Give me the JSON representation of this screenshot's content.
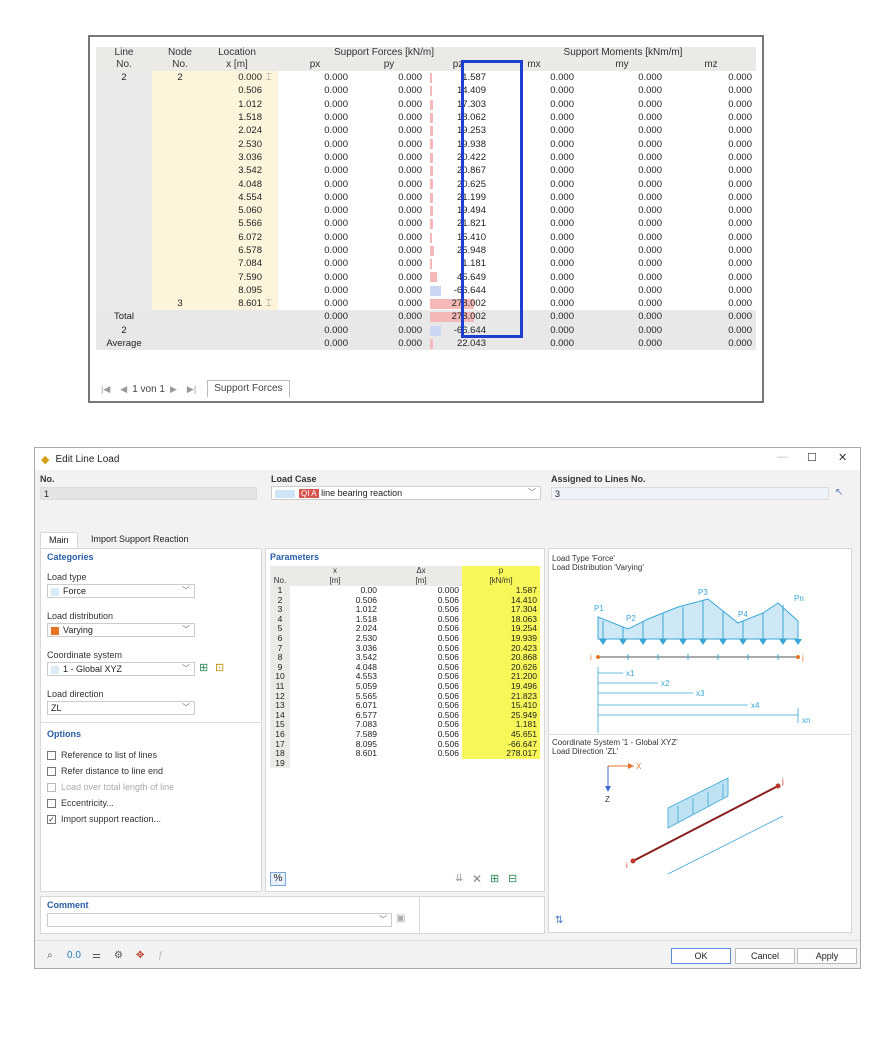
{
  "support_table": {
    "headers": {
      "line": [
        "Line",
        "No."
      ],
      "node": [
        "Node",
        "No."
      ],
      "location": [
        "Location",
        "x [m]"
      ],
      "forces_group": "Support Forces [kN/m]",
      "moments_group": "Support Moments [kNm/m]",
      "px": "px",
      "py": "py",
      "pz": "pz",
      "mx": "mx",
      "my": "my",
      "mz": "mz"
    },
    "line_no": "2",
    "rows": [
      {
        "node": "2",
        "x": "0.000",
        "sym": "⌶",
        "px": "0.000",
        "py": "0.000",
        "pz": "1.587",
        "pzval": 1.587,
        "mx": "0.000",
        "my": "0.000",
        "mz": "0.000"
      },
      {
        "node": "",
        "x": "0.506",
        "sym": "",
        "px": "0.000",
        "py": "0.000",
        "pz": "14.409",
        "pzval": 14.409,
        "mx": "0.000",
        "my": "0.000",
        "mz": "0.000"
      },
      {
        "node": "",
        "x": "1.012",
        "sym": "",
        "px": "0.000",
        "py": "0.000",
        "pz": "17.303",
        "pzval": 17.303,
        "mx": "0.000",
        "my": "0.000",
        "mz": "0.000"
      },
      {
        "node": "",
        "x": "1.518",
        "sym": "",
        "px": "0.000",
        "py": "0.000",
        "pz": "18.062",
        "pzval": 18.062,
        "mx": "0.000",
        "my": "0.000",
        "mz": "0.000"
      },
      {
        "node": "",
        "x": "2.024",
        "sym": "",
        "px": "0.000",
        "py": "0.000",
        "pz": "19.253",
        "pzval": 19.253,
        "mx": "0.000",
        "my": "0.000",
        "mz": "0.000"
      },
      {
        "node": "",
        "x": "2.530",
        "sym": "",
        "px": "0.000",
        "py": "0.000",
        "pz": "19.938",
        "pzval": 19.938,
        "mx": "0.000",
        "my": "0.000",
        "mz": "0.000"
      },
      {
        "node": "",
        "x": "3.036",
        "sym": "",
        "px": "0.000",
        "py": "0.000",
        "pz": "20.422",
        "pzval": 20.422,
        "mx": "0.000",
        "my": "0.000",
        "mz": "0.000"
      },
      {
        "node": "",
        "x": "3.542",
        "sym": "",
        "px": "0.000",
        "py": "0.000",
        "pz": "20.867",
        "pzval": 20.867,
        "mx": "0.000",
        "my": "0.000",
        "mz": "0.000"
      },
      {
        "node": "",
        "x": "4.048",
        "sym": "",
        "px": "0.000",
        "py": "0.000",
        "pz": "20.625",
        "pzval": 20.625,
        "mx": "0.000",
        "my": "0.000",
        "mz": "0.000"
      },
      {
        "node": "",
        "x": "4.554",
        "sym": "",
        "px": "0.000",
        "py": "0.000",
        "pz": "21.199",
        "pzval": 21.199,
        "mx": "0.000",
        "my": "0.000",
        "mz": "0.000"
      },
      {
        "node": "",
        "x": "5.060",
        "sym": "",
        "px": "0.000",
        "py": "0.000",
        "pz": "19.494",
        "pzval": 19.494,
        "mx": "0.000",
        "my": "0.000",
        "mz": "0.000"
      },
      {
        "node": "",
        "x": "5.566",
        "sym": "",
        "px": "0.000",
        "py": "0.000",
        "pz": "21.821",
        "pzval": 21.821,
        "mx": "0.000",
        "my": "0.000",
        "mz": "0.000"
      },
      {
        "node": "",
        "x": "6.072",
        "sym": "",
        "px": "0.000",
        "py": "0.000",
        "pz": "15.410",
        "pzval": 15.41,
        "mx": "0.000",
        "my": "0.000",
        "mz": "0.000"
      },
      {
        "node": "",
        "x": "6.578",
        "sym": "",
        "px": "0.000",
        "py": "0.000",
        "pz": "25.948",
        "pzval": 25.948,
        "mx": "0.000",
        "my": "0.000",
        "mz": "0.000"
      },
      {
        "node": "",
        "x": "7.084",
        "sym": "",
        "px": "0.000",
        "py": "0.000",
        "pz": "1.181",
        "pzval": 1.181,
        "mx": "0.000",
        "my": "0.000",
        "mz": "0.000"
      },
      {
        "node": "",
        "x": "7.590",
        "sym": "",
        "px": "0.000",
        "py": "0.000",
        "pz": "45.649",
        "pzval": 45.649,
        "mx": "0.000",
        "my": "0.000",
        "mz": "0.000"
      },
      {
        "node": "",
        "x": "8.095",
        "sym": "",
        "px": "0.000",
        "py": "0.000",
        "pz": "-66.644",
        "pzval": -66.644,
        "mx": "0.000",
        "my": "0.000",
        "mz": "0.000"
      },
      {
        "node": "3",
        "x": "8.601",
        "sym": "⌶",
        "px": "0.000",
        "py": "0.000",
        "pz": "278.002",
        "pzval": 278.002,
        "mx": "0.000",
        "my": "0.000",
        "mz": "0.000"
      }
    ],
    "summary": [
      {
        "label": "Total",
        "px": "0.000",
        "py": "0.000",
        "pz": "278.002",
        "pzval": 278.002,
        "mx": "0.000",
        "my": "0.000",
        "mz": "0.000"
      },
      {
        "label": "2",
        "px": "0.000",
        "py": "0.000",
        "pz": "-66.644",
        "pzval": -66.644,
        "mx": "0.000",
        "my": "0.000",
        "mz": "0.000"
      },
      {
        "label": "Average",
        "px": "0.000",
        "py": "0.000",
        "pz": "22.043",
        "pzval": 22.043,
        "mx": "0.000",
        "my": "0.000",
        "mz": "0.000"
      }
    ],
    "pager": "1 von 1",
    "sheet_tab": "Support Forces",
    "colors": {
      "positive_bar": "#f4b8b8",
      "negative_bar": "#c9d7f2",
      "highlight": "#1c3fd0"
    }
  },
  "dialog": {
    "title": "Edit Line Load",
    "no_label": "No.",
    "no_value": "1",
    "load_case_label": "Load Case",
    "load_case_code": "QI A",
    "load_case_name": "line bearing reaction",
    "assigned_label": "Assigned to Lines No.",
    "assigned_value": "3",
    "tabs": [
      "Main",
      "Import Support Reaction"
    ],
    "categories": {
      "heading": "Categories",
      "load_type_label": "Load type",
      "load_type_value": "Force",
      "load_dist_label": "Load distribution",
      "load_dist_value": "Varying",
      "coord_label": "Coordinate system",
      "coord_value": "1 - Global XYZ",
      "direction_label": "Load direction",
      "direction_value": "ZL"
    },
    "options": {
      "heading": "Options",
      "items": [
        {
          "label": "Reference to list of lines",
          "checked": false,
          "enabled": true
        },
        {
          "label": "Refer distance to line end",
          "checked": false,
          "enabled": true
        },
        {
          "label": "Load over total length of line",
          "checked": false,
          "enabled": false
        },
        {
          "label": "Eccentricity...",
          "checked": false,
          "enabled": true
        },
        {
          "label": "Import support reaction...",
          "checked": true,
          "enabled": true
        }
      ]
    },
    "parameters": {
      "heading": "Parameters",
      "col_no": "No.",
      "col_x": "x",
      "col_x_unit": "[m]",
      "col_dx": "Δx",
      "col_dx_unit": "[m]",
      "col_p": "p",
      "col_p_unit": "[kN/m]",
      "rows": [
        {
          "no": "1",
          "x": "0.00",
          "dx": "0.000",
          "p": "1.587"
        },
        {
          "no": "2",
          "x": "0.506",
          "dx": "0.506",
          "p": "14.410"
        },
        {
          "no": "3",
          "x": "1.012",
          "dx": "0.506",
          "p": "17.304"
        },
        {
          "no": "4",
          "x": "1.518",
          "dx": "0.506",
          "p": "18.063"
        },
        {
          "no": "5",
          "x": "2.024",
          "dx": "0.506",
          "p": "19.254"
        },
        {
          "no": "6",
          "x": "2.530",
          "dx": "0.506",
          "p": "19.939"
        },
        {
          "no": "7",
          "x": "3.036",
          "dx": "0.506",
          "p": "20.423"
        },
        {
          "no": "8",
          "x": "3.542",
          "dx": "0.506",
          "p": "20.868"
        },
        {
          "no": "9",
          "x": "4.048",
          "dx": "0.506",
          "p": "20.626"
        },
        {
          "no": "10",
          "x": "4.553",
          "dx": "0.506",
          "p": "21.200"
        },
        {
          "no": "11",
          "x": "5.059",
          "dx": "0.506",
          "p": "19.496"
        },
        {
          "no": "12",
          "x": "5.565",
          "dx": "0.506",
          "p": "21.823"
        },
        {
          "no": "13",
          "x": "6.071",
          "dx": "0.506",
          "p": "15.410"
        },
        {
          "no": "14",
          "x": "6.577",
          "dx": "0.506",
          "p": "25.949"
        },
        {
          "no": "15",
          "x": "7.083",
          "dx": "0.506",
          "p": "1.181"
        },
        {
          "no": "16",
          "x": "7.589",
          "dx": "0.506",
          "p": "45.651"
        },
        {
          "no": "17",
          "x": "8.095",
          "dx": "0.506",
          "p": "-66.647"
        },
        {
          "no": "18",
          "x": "8.601",
          "dx": "0.506",
          "p": "278.017"
        },
        {
          "no": "19",
          "x": "",
          "dx": "",
          "p": ""
        }
      ],
      "percent_btn": "%"
    },
    "diagram": {
      "line1": "Load Type 'Force'",
      "line2": "Load Distribution 'Varying'",
      "p_labels": [
        "P1",
        "P2",
        "P3",
        "P4",
        "Pn"
      ],
      "x_labels": [
        "x1",
        "x2",
        "x3",
        "x4",
        "xn"
      ],
      "node_i": "i",
      "node_j": "j",
      "coord_line1": "Coordinate System '1 - Global XYZ'",
      "coord_line2": "Load Direction 'ZL'",
      "axis_x": "X",
      "axis_z": "Z"
    },
    "comment_label": "Comment",
    "buttons": {
      "ok": "OK",
      "cancel": "Cancel",
      "apply": "Apply"
    },
    "colors": {
      "accent_yellow": "#f7f75a",
      "load_blue": "#3aa7d8",
      "varying_orange": "#e8742a",
      "lc_red": "#d9534f"
    }
  }
}
